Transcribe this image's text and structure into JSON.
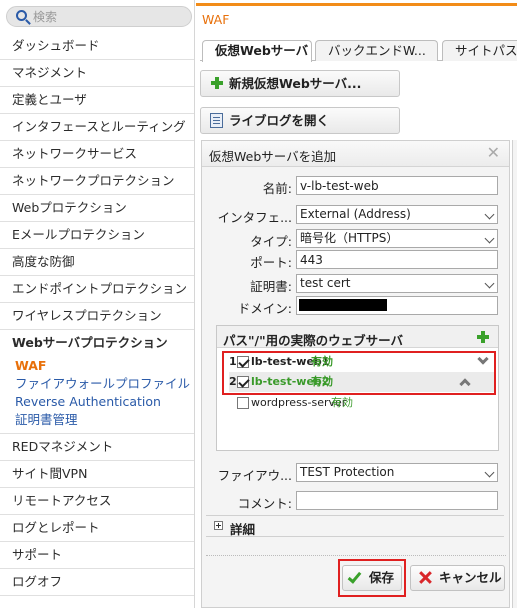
{
  "search": {
    "placeholder": "検索"
  },
  "sidebar": {
    "items": [
      {
        "label": "ダッシュボード"
      },
      {
        "label": "マネジメント"
      },
      {
        "label": "定義とユーザ"
      },
      {
        "label": "インタフェースとルーティング"
      },
      {
        "label": "ネットワークサービス"
      },
      {
        "label": "ネットワークプロテクション"
      },
      {
        "label": "Webプロテクション"
      },
      {
        "label": "Eメールプロテクション"
      },
      {
        "label": "高度な防御"
      },
      {
        "label": "エンドポイントプロテクション"
      },
      {
        "label": "ワイヤレスプロテクション"
      }
    ],
    "active_group": {
      "label": "Webサーバプロテクション",
      "subitems": [
        {
          "label": "WAF"
        },
        {
          "label": "ファイアウォールプロファイル"
        },
        {
          "label": "Reverse Authentication"
        },
        {
          "label": "証明書管理"
        }
      ]
    },
    "items_after": [
      {
        "label": "REDマネジメント"
      },
      {
        "label": "サイト間VPN"
      },
      {
        "label": "リモートアクセス"
      },
      {
        "label": "ログとレポート"
      },
      {
        "label": "サポート"
      },
      {
        "label": "ログオフ"
      }
    ]
  },
  "header": {
    "section_title": "WAF"
  },
  "tabs": [
    {
      "label": "仮想Webサーバ"
    },
    {
      "label": "バックエンドW..."
    },
    {
      "label": "サイトパス..."
    }
  ],
  "actions": {
    "new_virtual_server": "新規仮想Webサーバ...",
    "open_live_log": "ライブログを開く"
  },
  "dialog": {
    "title": "仮想Webサーバを追加",
    "close_glyph": "✕",
    "fields": {
      "name_label": "名前:",
      "name_value": "v-lb-test-web",
      "interface_label": "インタフェ...",
      "interface_value": "External (Address)",
      "type_label": "タイプ:",
      "type_value": "暗号化（HTTPS）",
      "port_label": "ポート:",
      "port_value": "443",
      "cert_label": "証明書:",
      "cert_value": "test cert",
      "domain_label": "ドメイン:",
      "firewall_label": "ファイアウ...",
      "firewall_value": "TEST Protection",
      "comment_label": "コメント:",
      "comment_value": ""
    },
    "servers": {
      "title": "パス\"/\"用の実際のウェブサーバ",
      "rows": [
        {
          "num": "1",
          "name": "lb-test-web1",
          "status": "有効",
          "checked": true
        },
        {
          "num": "2",
          "name": "lb-test-web2",
          "status": "有効",
          "checked": true
        },
        {
          "num": "",
          "name": "wordpress-server",
          "status": "有効",
          "checked": false
        }
      ]
    },
    "details_label": "詳細",
    "save_label": "保存",
    "cancel_label": "キャンセル"
  },
  "colors": {
    "accent": "#f28c18",
    "link": "#2a5aa8",
    "active_link": "#e8700a",
    "ok_green": "#3a9a2a",
    "highlight_red": "#e02020"
  }
}
